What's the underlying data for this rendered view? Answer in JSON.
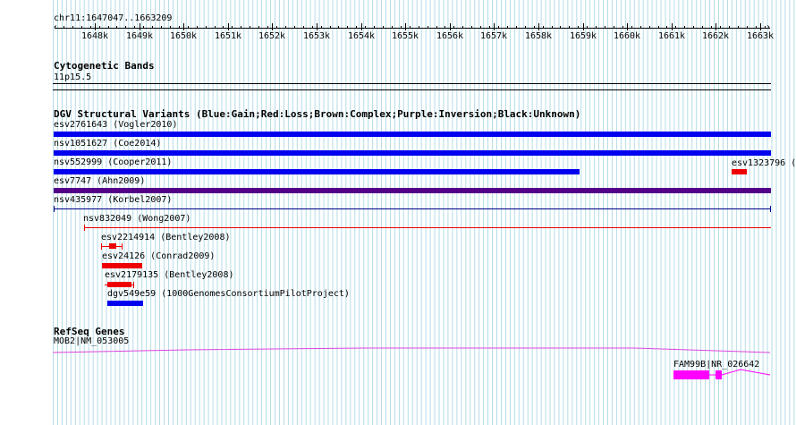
{
  "ruler": {
    "position_label": "chr11:1647047..1663209",
    "ticks": [
      "1648k",
      "1649k",
      "1650k",
      "1651k",
      "1652k",
      "1653k",
      "1654k",
      "1655k",
      "1656k",
      "1657k",
      "1658k",
      "1659k",
      "1660k",
      "1661k",
      "1662k",
      "1663k"
    ]
  },
  "cytoband": {
    "title": "Cytogenetic Bands",
    "band": "11p15.5"
  },
  "dgv": {
    "title": "DGV Structural Variants (Blue:Gain;Red:Loss;Brown:Complex;Purple:Inversion;Black:Unknown)",
    "features": [
      {
        "label": "esv2761643 (Vogler2010)",
        "color": "#0000ee"
      },
      {
        "label": "nsv1051627 (Coe2014)",
        "color": "#0000ee"
      },
      {
        "label": "nsv552999 (Cooper2011)",
        "color": "#0000ee"
      },
      {
        "label": "esv1323796 (",
        "color": "#ee0000"
      },
      {
        "label": "esv7747 (Ahn2009)",
        "color": "#550088"
      },
      {
        "label": "nsv435977 (Korbel2007)",
        "color": "#000088"
      },
      {
        "label": "nsv832049 (Wong2007)",
        "color": "#ee0000"
      },
      {
        "label": "esv2214914 (Bentley2008)",
        "color": "#ee0000"
      },
      {
        "label": "esv24126 (Conrad2009)",
        "color": "#ee0000"
      },
      {
        "label": "esv2179135 (Bentley2008)",
        "color": "#ee0000"
      },
      {
        "label": "dgv549e59 (1000GenomesConsortiumPilotProject)",
        "color": "#0000ee"
      }
    ]
  },
  "refseq": {
    "title": "RefSeq Genes",
    "genes": [
      {
        "label": "MOB2|NM_053005",
        "color": "#dd44dd"
      },
      {
        "label": "FAM99B|NR_026642",
        "color": "#ff00ff"
      }
    ]
  },
  "colors": {
    "grid": "#b4dce8",
    "gain": "#0000ee",
    "loss": "#ee0000",
    "inversion": "#550088",
    "gene": "#ff00ff"
  }
}
